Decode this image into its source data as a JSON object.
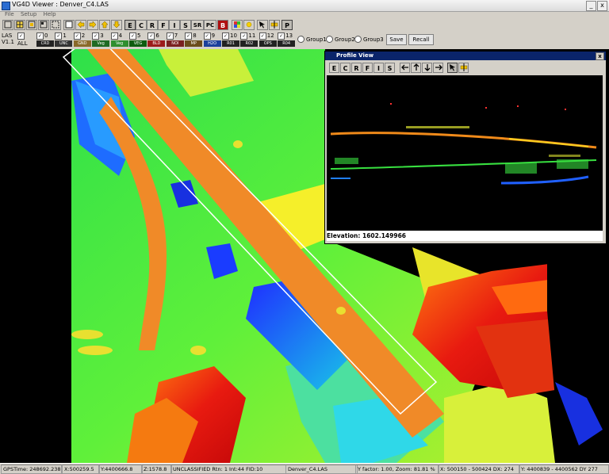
{
  "window": {
    "title": "VG4D Viewer : Denver_C4.LAS",
    "min": "_",
    "close": "x"
  },
  "menu": [
    "File",
    "Setup",
    "Help"
  ],
  "toolbar": {
    "E": "E",
    "C": "C",
    "R": "R",
    "F": "F",
    "I": "I",
    "S": "S",
    "SR": "SR",
    "PC": "PC",
    "B": "B",
    "P": "P"
  },
  "classbar": {
    "las_label": "LAS",
    "las_version": "V1.1",
    "all_label": "ALL",
    "classes": [
      {
        "num": "0",
        "code": "CRD",
        "color": "#222222"
      },
      {
        "num": "1",
        "code": "UNC",
        "color": "#333333"
      },
      {
        "num": "2",
        "code": "GND",
        "color": "#8a6a2a"
      },
      {
        "num": "3",
        "code": "Veg",
        "color": "#1f6b24"
      },
      {
        "num": "4",
        "code": "Veg",
        "color": "#2f8f2f"
      },
      {
        "num": "5",
        "code": "VEG",
        "color": "#0e5c10"
      },
      {
        "num": "6",
        "code": "BLD",
        "color": "#9c1b1b"
      },
      {
        "num": "7",
        "code": "NOI",
        "color": "#7a2020"
      },
      {
        "num": "8",
        "code": "MP",
        "color": "#6a4b1b"
      },
      {
        "num": "9",
        "code": "H2O",
        "color": "#1b3f9c"
      },
      {
        "num": "10",
        "code": "R01",
        "color": "#222222"
      },
      {
        "num": "11",
        "code": "R02",
        "color": "#222222"
      },
      {
        "num": "12",
        "code": "OPS",
        "color": "#222222"
      },
      {
        "num": "13",
        "code": "R04",
        "color": "#222222"
      }
    ],
    "group1": "Group1",
    "group2": "Group2",
    "group3": "Group3",
    "save": "Save",
    "recall": "Recall"
  },
  "profile": {
    "title": "Profile View",
    "close": "x",
    "tools": [
      "E",
      "C",
      "R",
      "F",
      "I",
      "S"
    ],
    "elevation": "Elevation: 1602.149966"
  },
  "status": {
    "gps": "GPSTime: 248692.23814",
    "x": "X:500259.5",
    "y": "Y:4400666.8",
    "z": "Z:1578.8",
    "class": "UNCLASSIFIED Rtn: 1 Int:44 FID:10",
    "file": "Denver_C4.LAS",
    "factor": "Y factor: 1.00, Zoom: 81.81 %",
    "xrange": "X: 500150 - 500424 DX: 274",
    "yrange": "Y: 4400839 - 4400562 DY 277"
  }
}
